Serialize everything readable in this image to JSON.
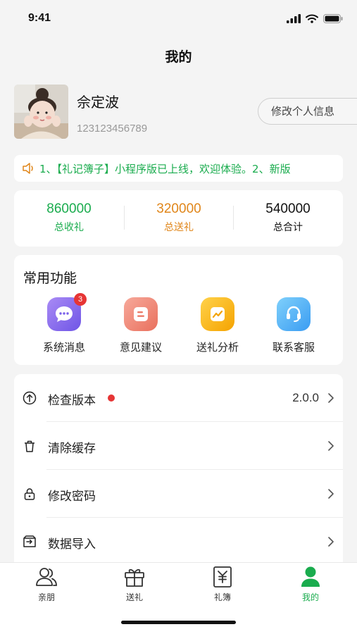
{
  "status": {
    "time": "9:41"
  },
  "header": {
    "title": "我的"
  },
  "profile": {
    "name": "佘定波",
    "phone": "123123456789",
    "edit_label": "修改个人信息"
  },
  "notice": {
    "text": "1、【礼记簿子】小程序版已上线，欢迎体验。2、新版"
  },
  "stats": [
    {
      "value": "860000",
      "label": "总收礼",
      "color": "#1aac4e"
    },
    {
      "value": "320000",
      "label": "总送礼",
      "color": "#e0861a"
    },
    {
      "value": "540000",
      "label": "总合计",
      "color": "#111111"
    }
  ],
  "functions": {
    "title": "常用功能",
    "items": [
      {
        "label": "系统消息",
        "icon": "message-icon",
        "badge": "3"
      },
      {
        "label": "意见建议",
        "icon": "feedback-icon"
      },
      {
        "label": "送礼分析",
        "icon": "chart-icon"
      },
      {
        "label": "联系客服",
        "icon": "headset-icon"
      }
    ]
  },
  "settings": [
    {
      "label": "检查版本",
      "icon": "update-icon",
      "value": "2.0.0"
    },
    {
      "label": "清除缓存",
      "icon": "trash-icon"
    },
    {
      "label": "修改密码",
      "icon": "lock-icon"
    },
    {
      "label": "数据导入",
      "icon": "import-icon"
    }
  ],
  "tabs": [
    {
      "label": "亲朋",
      "icon": "friends-icon",
      "active": false
    },
    {
      "label": "送礼",
      "icon": "gift-icon",
      "active": false
    },
    {
      "label": "礼簿",
      "icon": "ledger-icon",
      "active": false
    },
    {
      "label": "我的",
      "icon": "profile-icon",
      "active": true
    }
  ],
  "colors": {
    "accent": "#1aac4e",
    "orange": "#e0861a",
    "badge": "#e63535"
  }
}
